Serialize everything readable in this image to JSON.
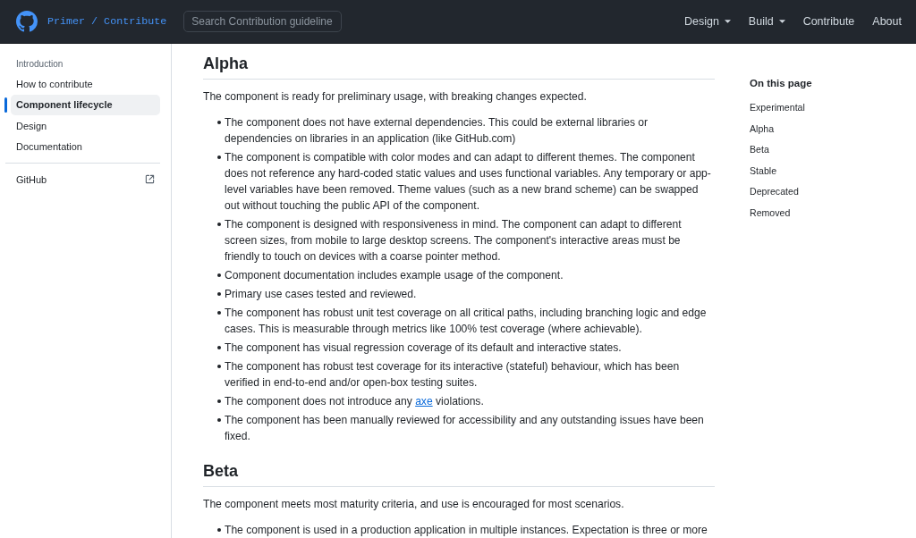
{
  "header": {
    "title": "Primer / Contribute",
    "search": {
      "placeholder": "Search Contribution guideline"
    },
    "nav": [
      {
        "label": "Design",
        "dropdown": true
      },
      {
        "label": "Build",
        "dropdown": true
      },
      {
        "label": "Contribute",
        "dropdown": false
      },
      {
        "label": "About",
        "dropdown": false
      }
    ]
  },
  "sidebar": {
    "heading": "Introduction",
    "items": [
      {
        "label": "How to contribute",
        "selected": false
      },
      {
        "label": "Component lifecycle",
        "selected": true
      },
      {
        "label": "Design",
        "selected": false
      },
      {
        "label": "Documentation",
        "selected": false
      }
    ],
    "links": [
      {
        "label": "GitHub",
        "external": true
      }
    ]
  },
  "content": {
    "sections": [
      {
        "title": "Alpha",
        "intro": "The component is ready for preliminary usage, with breaking changes expected.",
        "items": [
          {
            "text": "The component does not have external dependencies. This could be external libraries or dependencies on libraries in an application (like GitHub.com)"
          },
          {
            "text": "The component is compatible with color modes and can adapt to different themes. The component does not reference any hard-coded static values and uses functional variables. Any temporary or app-level variables have been removed. Theme values (such as a new brand scheme) can be swapped out without touching the public API of the component."
          },
          {
            "text": "The component is designed with responsiveness in mind. The component can adapt to different screen sizes, from mobile to large desktop screens. The component's interactive areas must be friendly to touch on devices with a coarse pointer method."
          },
          {
            "text": "Component documentation includes example usage of the component."
          },
          {
            "text": "Primary use cases tested and reviewed."
          },
          {
            "text": "The component has robust unit test coverage on all critical paths, including branching logic and edge cases. This is measurable through metrics like 100% test coverage (where achievable)."
          },
          {
            "text": "The component has visual regression coverage of its default and interactive states."
          },
          {
            "text": "The component has robust test coverage for its interactive (stateful) behaviour, which has been verified in end-to-end and/or open-box testing suites."
          },
          {
            "text": "The component does not introduce any ",
            "link": "axe",
            "after": " violations."
          },
          {
            "text": "The component has been manually reviewed for accessibility and any outstanding issues have been fixed."
          }
        ]
      },
      {
        "title": "Beta",
        "intro": "The component meets most maturity criteria, and use is encouraged for most scenarios.",
        "items": [
          {
            "text": "The component is used in a production application in multiple instances. Expectation is three or more"
          }
        ]
      }
    ]
  },
  "toc": {
    "title": "On this page",
    "items": [
      "Experimental",
      "Alpha",
      "Beta",
      "Stable",
      "Deprecated",
      "Removed"
    ]
  }
}
